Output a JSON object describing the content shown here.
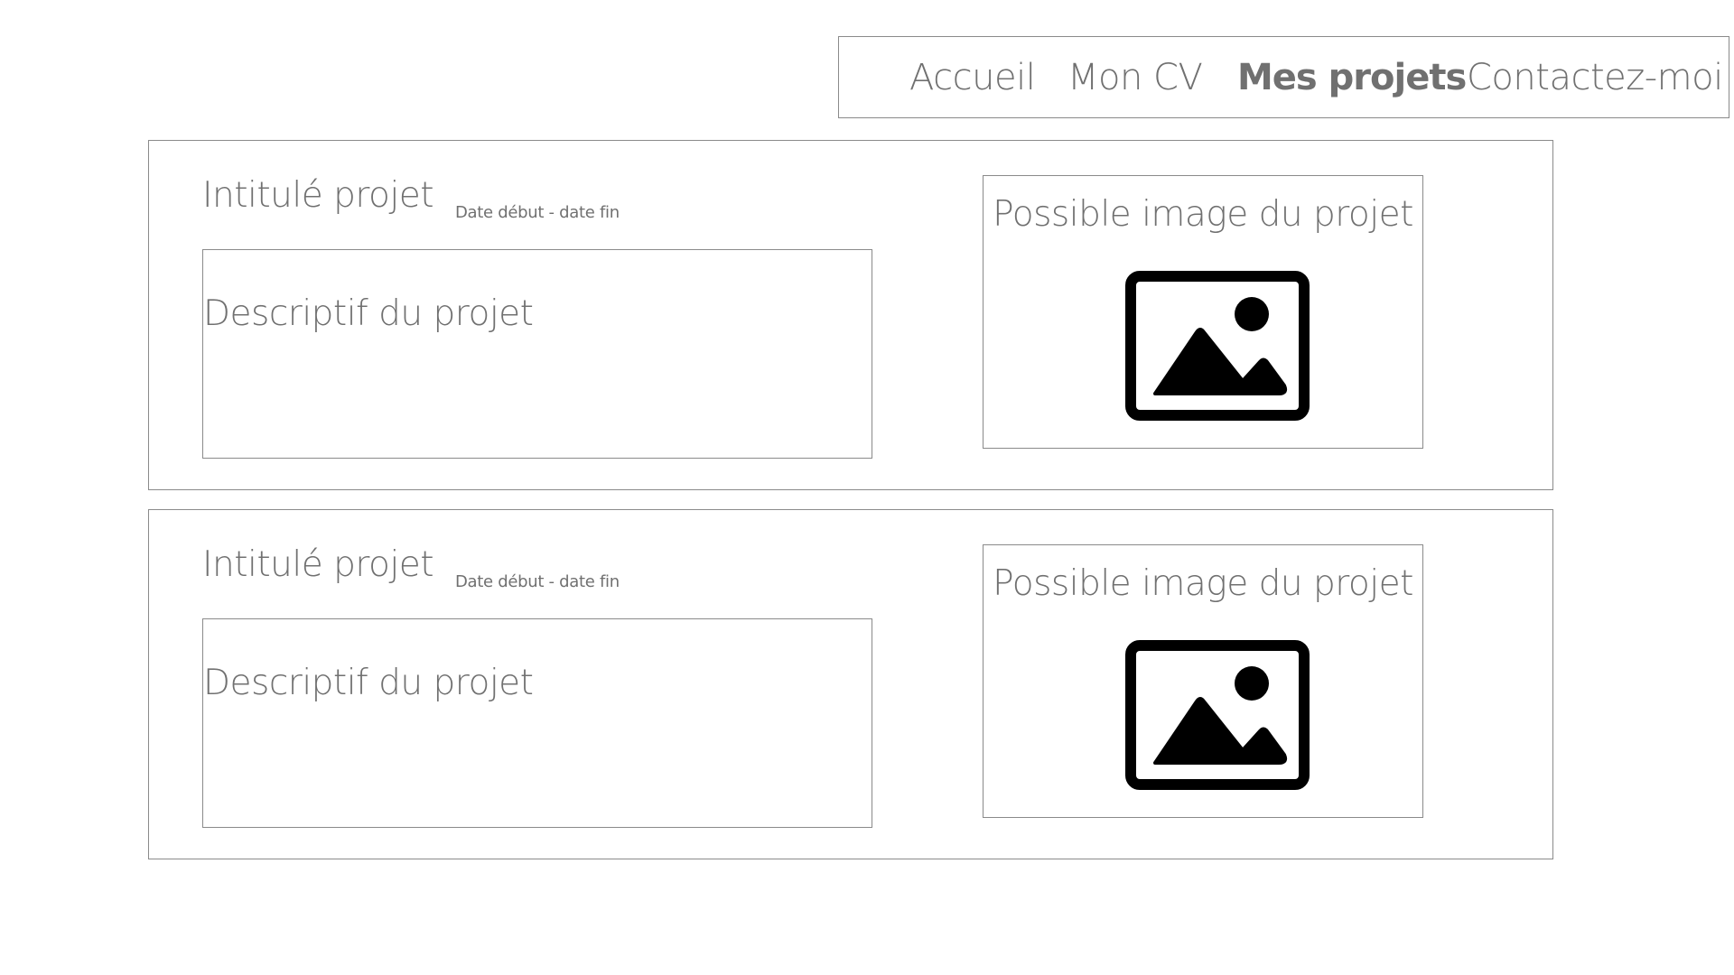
{
  "nav": {
    "items": [
      {
        "label": "Accueil",
        "active": false
      },
      {
        "label": "Mon CV",
        "active": false
      },
      {
        "label": "Mes projets",
        "active": true
      },
      {
        "label": "Contactez-moi",
        "active": false
      }
    ]
  },
  "projects": [
    {
      "title": "Intitulé projet",
      "dates": "Date début - date fin",
      "description": "Descriptif du projet",
      "image_caption": "Possible image du projet",
      "image_icon": "image-placeholder-icon"
    },
    {
      "title": "Intitulé projet",
      "dates": "Date début - date fin",
      "description": "Descriptif du projet",
      "image_caption": "Possible image du projet",
      "image_icon": "image-placeholder-icon"
    }
  ]
}
